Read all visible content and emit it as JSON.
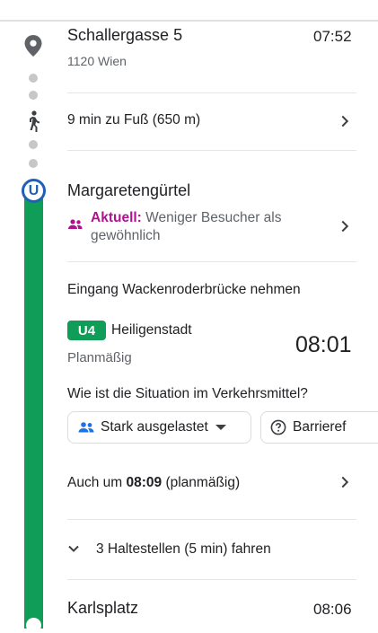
{
  "origin": {
    "name": "Schallergasse 5",
    "time": "07:52",
    "district": "1120 Wien"
  },
  "walk": {
    "label": "9 min zu Fuß (650 m)"
  },
  "station": {
    "badge": "U",
    "name": "Margaretengürtel",
    "crowd_label": "Aktuell:",
    "crowd_text": "Weniger Besucher als gewöhnlich"
  },
  "entrance": "Eingang Wackenroderbrücke nehmen",
  "line": {
    "number": "U4",
    "direction": "Heiligenstadt",
    "status": "Planmäßig",
    "departure": "08:01"
  },
  "vehicle_question": "Wie ist die Situation im Verkehrsmittel?",
  "chips": {
    "crowd": "Stark ausgelastet",
    "access": "Barrieref"
  },
  "also": {
    "prefix": "Auch um",
    "time": "08:09",
    "suffix": "(planmäßig)"
  },
  "stops": {
    "label": "3 Haltestellen (5 min) fahren"
  },
  "destination": {
    "name": "Karlsplatz",
    "time": "08:06"
  },
  "colors": {
    "line_green": "#0f9d58",
    "ubahn_blue": "#1f62b5",
    "crowd_purple": "#b0128d"
  },
  "icons": [
    "location-pin-icon",
    "walk-icon",
    "ubahn-icon",
    "people-icon",
    "chevron-right-icon",
    "chevron-down-icon",
    "caret-down-icon",
    "question-icon"
  ]
}
